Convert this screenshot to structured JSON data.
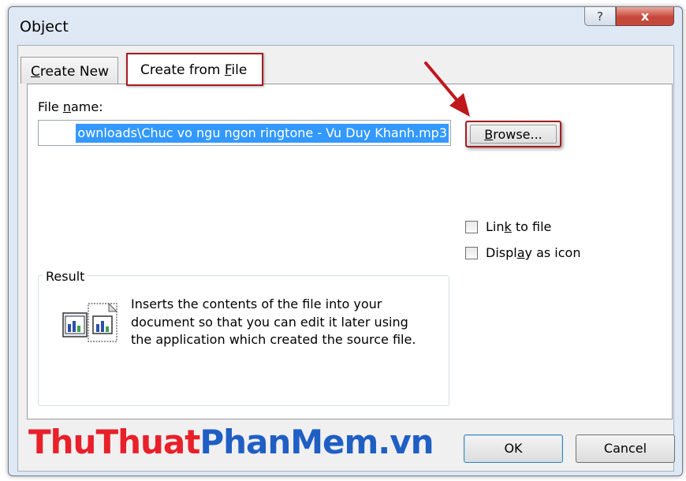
{
  "window": {
    "title": "Object",
    "help_glyph": "?",
    "close_glyph": "x"
  },
  "tabs": [
    {
      "prefix": "",
      "mnemonic": "C",
      "rest": "reate New",
      "selected": false
    },
    {
      "prefix": "Create from ",
      "mnemonic": "F",
      "rest": "ile",
      "selected": true
    }
  ],
  "file_name": {
    "label_prefix": "File ",
    "label_mnemonic": "n",
    "label_rest": "ame:",
    "value": "ownloads\\Chuc vo ngu ngon ringtone - Vu Duy Khanh.mp3"
  },
  "browse": {
    "mnemonic": "B",
    "rest": "rowse..."
  },
  "options": {
    "link": {
      "prefix": "Lin",
      "mnemonic": "k",
      "rest": " to file",
      "checked": false
    },
    "display_icon": {
      "prefix": "Displ",
      "mnemonic": "a",
      "rest": "y as icon",
      "checked": false
    }
  },
  "result": {
    "legend": "Result",
    "text": "Inserts the contents of the file into your document so that you can edit it later using the application which created the source file.",
    "icon": "insert-file-icon"
  },
  "buttons": {
    "ok": "OK",
    "cancel": "Cancel"
  },
  "watermark": {
    "part1": "ThuThuat",
    "part2": "PhanMem.vn"
  },
  "colors": {
    "highlight_border": "#a51d22",
    "selection": "#3399ff",
    "watermark_red": "#e8202a",
    "watermark_blue": "#1f5fc4"
  }
}
